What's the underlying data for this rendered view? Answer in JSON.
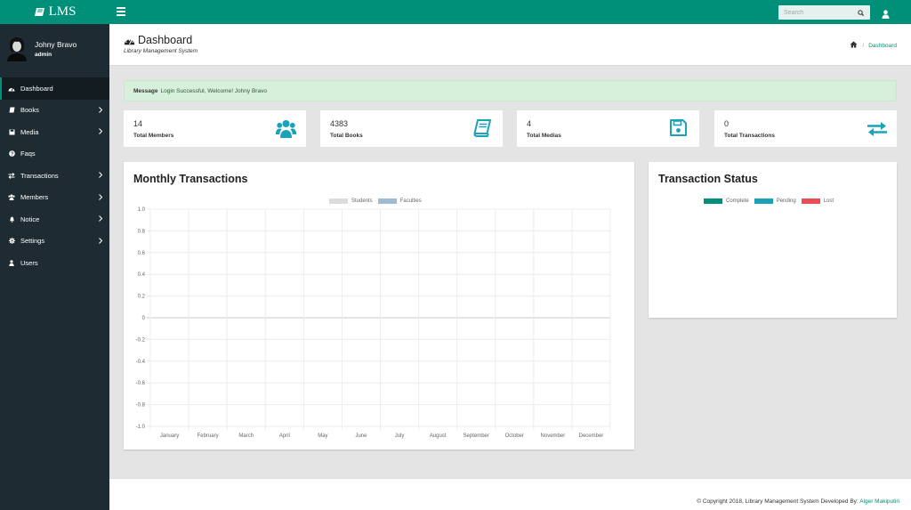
{
  "app": {
    "brand": "LMS"
  },
  "search": {
    "placeholder": "Search"
  },
  "profile": {
    "name": "Johny Bravo",
    "role": "admin"
  },
  "sidebar": {
    "items": [
      {
        "label": "Dashboard",
        "icon": "dashboard-icon",
        "active": true,
        "chevron": false
      },
      {
        "label": "Books",
        "icon": "book-icon",
        "chevron": true
      },
      {
        "label": "Media",
        "icon": "media-icon",
        "chevron": true
      },
      {
        "label": "Faqs",
        "icon": "question-icon",
        "chevron": false
      },
      {
        "label": "Transactions",
        "icon": "exchange-icon",
        "chevron": true
      },
      {
        "label": "Members",
        "icon": "users-icon",
        "chevron": true
      },
      {
        "label": "Notice",
        "icon": "bell-icon",
        "chevron": true
      },
      {
        "label": "Settings",
        "icon": "gear-icon",
        "chevron": true
      },
      {
        "label": "Users",
        "icon": "user-icon",
        "chevron": false
      }
    ]
  },
  "header": {
    "title": "Dashboard",
    "subtitle": "Library Management System",
    "breadcrumb": {
      "current": "Dashboard"
    }
  },
  "alert": {
    "label": "Message",
    "text": "Login Successful, Welcome! Johny Bravo"
  },
  "stats": [
    {
      "value": "14",
      "label": "Total Members",
      "icon": "users-icon"
    },
    {
      "value": "4383",
      "label": "Total Books",
      "icon": "book-icon"
    },
    {
      "value": "4",
      "label": "Total Medias",
      "icon": "floppy-disk-icon"
    },
    {
      "value": "0",
      "label": "Total Transactions",
      "icon": "exchange-icon"
    }
  ],
  "colors": {
    "brand": "#00907a",
    "sidebar": "#1f2b33",
    "stat_icon": "#1aa3b8",
    "students": "#dcdcdc",
    "faculties": "#9fbbd2",
    "complete": "#00907a",
    "pending": "#1aa3b8",
    "lost": "#ef4b55"
  },
  "monthly_panel": {
    "title": "Monthly Transactions"
  },
  "status_panel": {
    "title": "Transaction Status"
  },
  "chart_data": [
    {
      "type": "bar",
      "title": "Monthly Transactions",
      "categories": [
        "January",
        "February",
        "March",
        "April",
        "May",
        "June",
        "July",
        "August",
        "September",
        "October",
        "November",
        "December"
      ],
      "series": [
        {
          "name": "Students",
          "values": [
            0,
            0,
            0,
            0,
            0,
            0,
            0,
            0,
            0,
            0,
            0,
            0
          ]
        },
        {
          "name": "Faculties",
          "values": [
            0,
            0,
            0,
            0,
            0,
            0,
            0,
            0,
            0,
            0,
            0,
            0
          ]
        }
      ],
      "yticks": [
        "1.0",
        "0.8",
        "0.6",
        "0.4",
        "0.2",
        "0",
        "-0.2",
        "-0.4",
        "-0.6",
        "-0.8",
        "-1.0"
      ],
      "ylim": [
        -1,
        1
      ],
      "grid": true,
      "legend": "top-center"
    },
    {
      "type": "pie",
      "title": "Transaction Status",
      "categories": [
        "Complete",
        "Pending",
        "Lost"
      ],
      "values": [
        0,
        0,
        0
      ],
      "legend": "top-center"
    }
  ],
  "footer": {
    "text": "© Copyright 2018, Library Management System Developed By:",
    "author": "Alger Makiputin"
  }
}
